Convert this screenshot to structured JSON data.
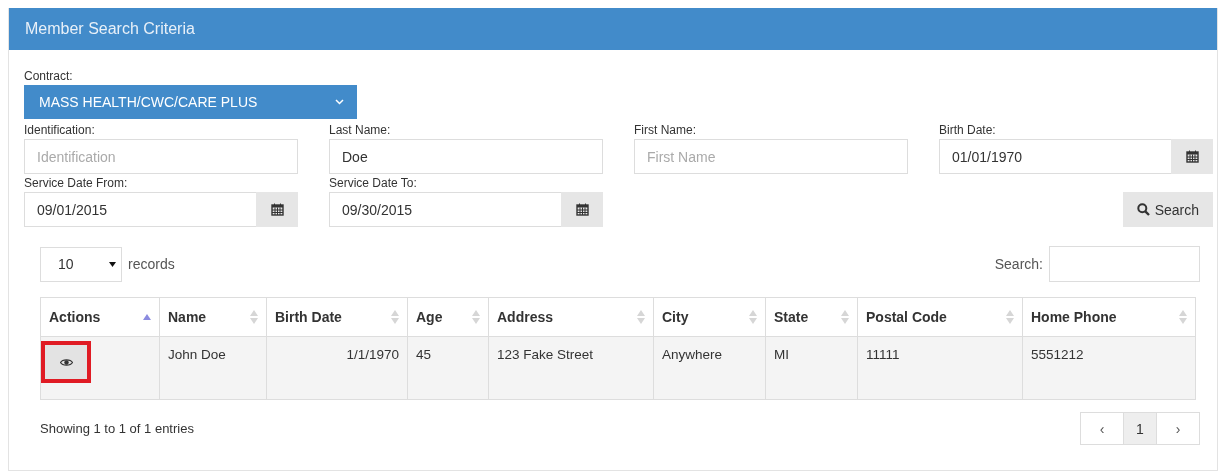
{
  "panel": {
    "title": "Member Search Criteria"
  },
  "contract": {
    "label": "Contract:",
    "value": "MASS HEALTH/CWC/CARE PLUS"
  },
  "fields": [
    {
      "kind": "text",
      "label": "Identification:",
      "placeholder": "Identification"
    },
    {
      "kind": "text",
      "label": "Last Name:",
      "value": "Doe"
    },
    {
      "kind": "text",
      "label": "First Name:",
      "placeholder": "First Name"
    },
    {
      "kind": "date",
      "label": "Birth Date:",
      "value": "01/01/1970"
    },
    {
      "kind": "date",
      "label": "Service Date From:",
      "value": "09/01/2015"
    },
    {
      "kind": "date",
      "label": "Service Date To:",
      "value": "09/30/2015"
    }
  ],
  "search_button": {
    "label": "Search"
  },
  "table_controls": {
    "page_size": "10",
    "page_size_label": "records",
    "search_label": "Search:"
  },
  "table": {
    "columns": [
      {
        "label": "Actions",
        "sorted": true
      },
      {
        "label": "Name",
        "sorted": false
      },
      {
        "label": "Birth Date",
        "sorted": false
      },
      {
        "label": "Age",
        "sorted": false
      },
      {
        "label": "Address",
        "sorted": false
      },
      {
        "label": "City",
        "sorted": false
      },
      {
        "label": "State",
        "sorted": false
      },
      {
        "label": "Postal Code",
        "sorted": false
      },
      {
        "label": "Home Phone",
        "sorted": false
      }
    ],
    "rows": [
      {
        "highlighted": true,
        "cells": [
          "",
          "John Doe",
          "1/1/1970",
          "45",
          "123 Fake Street",
          "Anywhere",
          "MI",
          "11111",
          "5551212"
        ]
      }
    ]
  },
  "footer": {
    "info": "Showing 1 to 1 of 1 entries"
  },
  "pagination": [
    {
      "label": "‹",
      "selected": false
    },
    {
      "label": "1",
      "selected": true
    },
    {
      "label": "›",
      "selected": false
    }
  ]
}
